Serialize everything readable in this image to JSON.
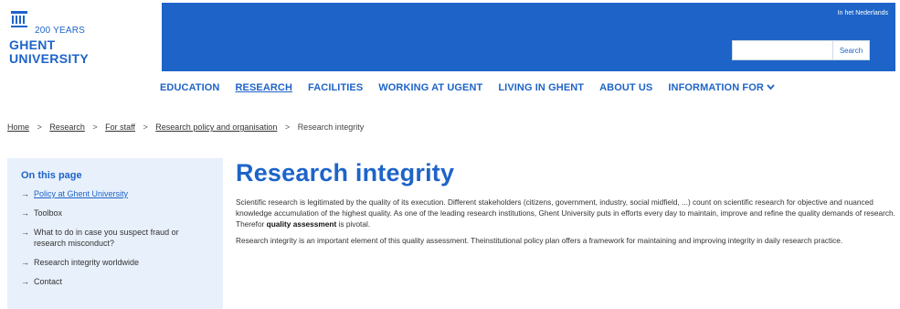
{
  "logo": {
    "years": "200 YEARS",
    "name_line1": "GHENT",
    "name_line2": "UNIVERSITY"
  },
  "header": {
    "lang_link": "In het Nederlands",
    "search_placeholder": "",
    "search_button": "Search",
    "brand_color": "#1e64c8"
  },
  "mainnav": {
    "items": [
      {
        "label": "EDUCATION"
      },
      {
        "label": "RESEARCH"
      },
      {
        "label": "FACILITIES"
      },
      {
        "label": "WORKING AT UGENT"
      },
      {
        "label": "LIVING IN GHENT"
      },
      {
        "label": "ABOUT US"
      },
      {
        "label": "INFORMATION FOR"
      }
    ],
    "active": "RESEARCH"
  },
  "breadcrumb": {
    "items": [
      "Home",
      "Research",
      "For staff",
      "Research policy and organisation",
      "Research integrity"
    ],
    "separator": ">"
  },
  "sidebar": {
    "title": "On this page",
    "arrow": "→",
    "items": [
      {
        "label": "Policy at Ghent University"
      },
      {
        "label": "Toolbox"
      },
      {
        "label": "What to do in case you suspect fraud or research misconduct?"
      },
      {
        "label": "Research integrity worldwide"
      },
      {
        "label": "Contact"
      }
    ]
  },
  "content": {
    "title": "Research integrity",
    "p1_before_bold": "Scientific research is legitimated by the quality of its execution. Different stakeholders (citizens, government, industry, social midfield, ...) count on scientific research for objective and nuanced knowledge accumulation of the highest quality. As one of the leading research institutions, Ghent University puts in efforts every day to maintain, improve and refine the quality demands of research. Therefor ",
    "p1_bold": "quality assessment",
    "p1_after_bold": " is pivotal.",
    "p2": "Research integrity is an important element of this quality assessment. Theinstitutional policy plan offers a framework for maintaining and improving integrity in daily research practice."
  }
}
